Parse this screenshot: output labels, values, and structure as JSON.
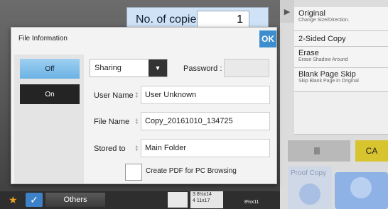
{
  "header": {
    "copies_label": "No. of copies",
    "copies_value": "1"
  },
  "right_menu": [
    {
      "title": "Original",
      "subtitle": "Change Size/Direction."
    },
    {
      "title": "2-Sided Copy",
      "subtitle": ""
    },
    {
      "title": "Erase",
      "subtitle": "Erase Shadow Around"
    },
    {
      "title": "Blank Page Skip",
      "subtitle": "Skip Blank Page in Original"
    }
  ],
  "actions": {
    "ca_label": "CA",
    "proof_label": "Proof Copy"
  },
  "bottom": {
    "others_label": "Others",
    "tray_line1": "3  8½x14",
    "tray_line2": "4  11x17",
    "tray_size": "8½x11"
  },
  "dialog": {
    "title": "File Information",
    "ok_label": "OK",
    "off_label": "Off",
    "on_label": "On",
    "share_value": "Sharing",
    "password_label": "Password :",
    "user_name_label": "User Name",
    "user_name_value": "User Unknown",
    "file_name_label": "File Name",
    "file_name_value": "Copy_20161010_134725",
    "stored_to_label": "Stored to",
    "stored_to_value": "Main Folder",
    "pdf_label": "Create PDF for PC Browsing"
  },
  "colors": {
    "accent": "#3d8ecf",
    "selected": "#7abde8",
    "ca": "#d7c42f"
  }
}
